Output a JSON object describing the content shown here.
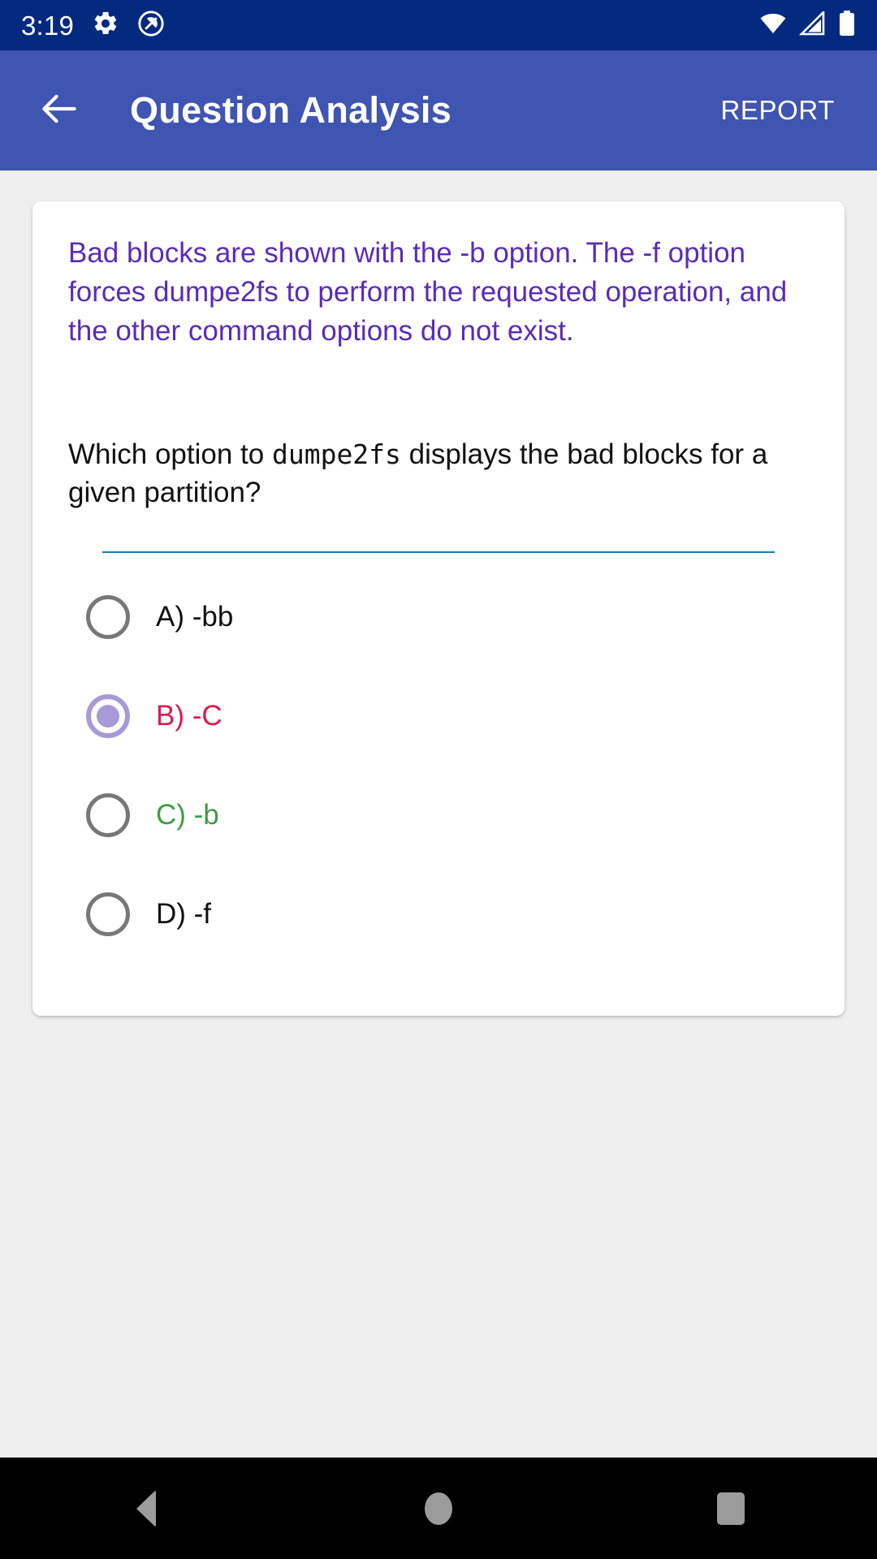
{
  "status_bar": {
    "time": "3:19",
    "left_icons": [
      "gear-icon",
      "q-circle-icon"
    ],
    "right_icons": [
      "wifi-icon",
      "cell-signal-icon",
      "battery-icon"
    ],
    "background_color": "#042a80",
    "foreground_color": "#ffffff"
  },
  "app_bar": {
    "back_icon": "back-arrow-icon",
    "title": "Question Analysis",
    "action_label": "REPORT",
    "background_color": "#4054b2",
    "text_color": "#ffffff"
  },
  "card": {
    "explanation": "Bad blocks are shown with the -b option. The -f option forces dumpe2fs to perform the requested operation, and the other command options do not exist.",
    "explanation_color": "#5b2bb8",
    "question": {
      "prefix": "Which option to ",
      "code": "dumpe2fs",
      "suffix": " displays the bad blocks for a given partition?",
      "color": "#111111"
    },
    "divider_color": "#1f7ab5",
    "options": [
      {
        "label": "A) -bb",
        "selected": false,
        "state": "neutral",
        "color": "#111111"
      },
      {
        "label": "B) -C",
        "selected": true,
        "state": "wrong",
        "color": "#e0194e"
      },
      {
        "label": "C) -b",
        "selected": false,
        "state": "correct",
        "color": "#3f9c46"
      },
      {
        "label": "D) -f",
        "selected": false,
        "state": "neutral",
        "color": "#111111"
      }
    ],
    "radio_selected_color": "#a79ad6",
    "radio_unselected_color": "#787878",
    "background_color": "#ffffff"
  },
  "page": {
    "background_color": "#efefef"
  },
  "nav_bar": {
    "background_color": "#000000",
    "icon_color": "#9b9b9b",
    "buttons": [
      "nav-back-icon",
      "nav-home-icon",
      "nav-recents-icon"
    ]
  }
}
